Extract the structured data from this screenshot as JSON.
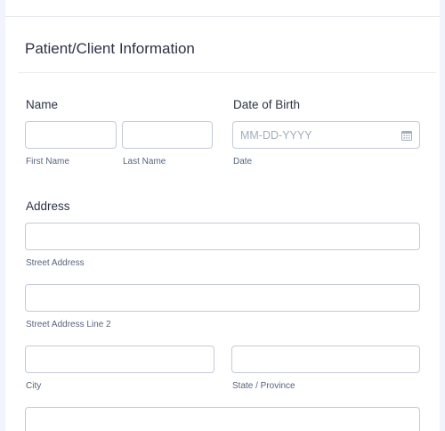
{
  "section": {
    "title": "Patient/Client Information"
  },
  "name_field": {
    "label": "Name",
    "first_sublabel": "First Name",
    "last_sublabel": "Last Name"
  },
  "dob_field": {
    "label": "Date of Birth",
    "placeholder": "MM-DD-YYYY",
    "sublabel": "Date",
    "icon": "calendar-icon"
  },
  "address_field": {
    "label": "Address",
    "street_sublabel": "Street Address",
    "street2_sublabel": "Street Address Line 2",
    "city_sublabel": "City",
    "state_sublabel": "State / Province"
  }
}
